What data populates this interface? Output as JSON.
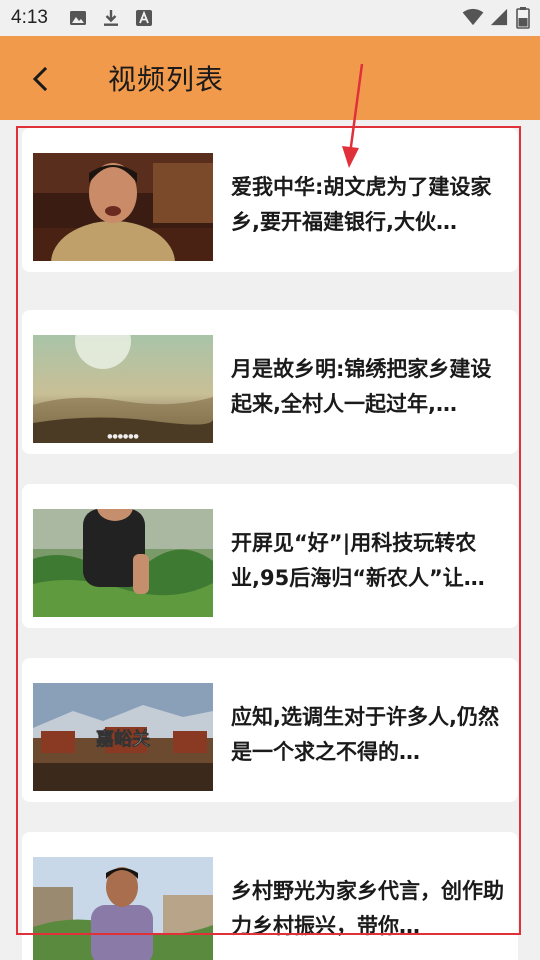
{
  "status_bar": {
    "time": "4:13",
    "icons_left": [
      "image-icon",
      "download-icon",
      "text-a-icon"
    ],
    "icons_right": [
      "wifi-icon",
      "signal-icon",
      "battery-icon"
    ]
  },
  "app_bar": {
    "title": "视频列表",
    "back_icon": "chevron-left-icon",
    "color": "#f29a4c"
  },
  "videos": [
    {
      "title": "爱我中华:胡文虎为了建设家乡,要开福建银行,大伙…",
      "thumb": "man-in-office-scene"
    },
    {
      "title": "月是故乡明:锦绣把家乡建设起来,全村人一起过年,…",
      "thumb": "misty-landscape-sunrise"
    },
    {
      "title": "开屏见“好”|用科技玩转农业,95后海归“新农人”让…",
      "thumb": "farmer-in-greenhouse"
    },
    {
      "title": "应知,选调生对于许多人,仍然是一个求之不得的…",
      "thumb": "jiayuguan-fortress",
      "thumb_text": "嘉峪关"
    },
    {
      "title": "乡村野光为家乡代言，创作助力乡村振兴，带你…",
      "thumb": "young-man-village"
    }
  ],
  "annotation_color": "#e0303a"
}
